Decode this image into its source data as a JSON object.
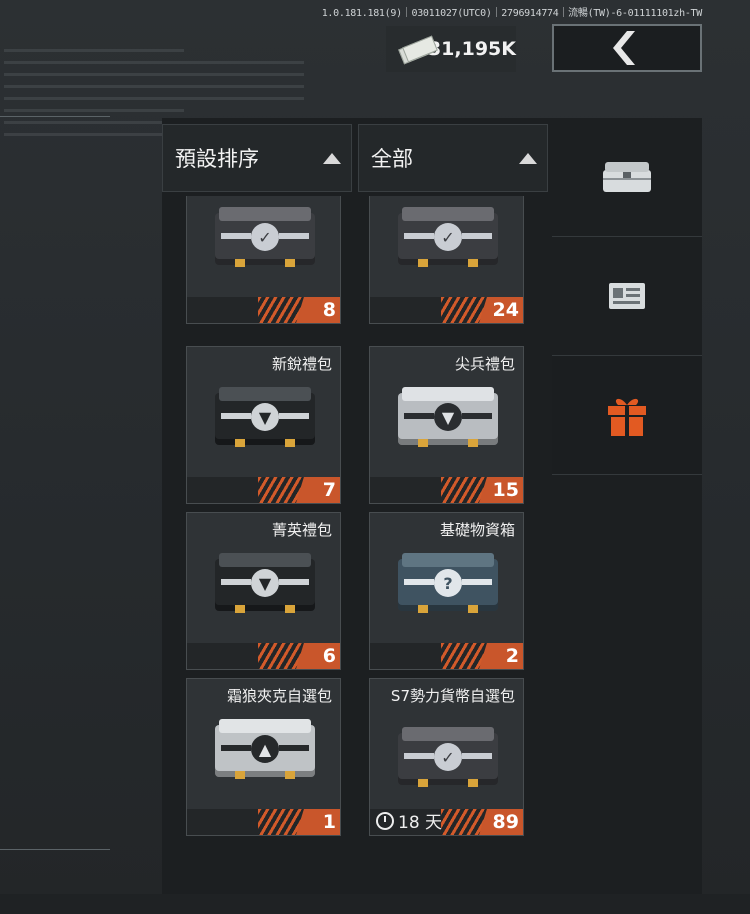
{
  "build_info": "1.0.181.181(9)｜03011027(UTC0)｜2796914774｜流暢(TW)-6-01111101zh-TW",
  "currency": {
    "icon": "cash-icon",
    "amount": "31,195K"
  },
  "back_button": {
    "icon": "chevron-left-icon"
  },
  "sort": {
    "label": "預設排序",
    "icon": "triangle-up-icon"
  },
  "filter": {
    "label": "全部",
    "icon": "triangle-up-icon"
  },
  "sidebar": [
    {
      "icon": "chest-icon",
      "active": false
    },
    {
      "icon": "card-icon",
      "active": false
    },
    {
      "icon": "gift-icon",
      "active": true
    }
  ],
  "accent_color": "#d25a2a",
  "items": [
    {
      "name": "",
      "count": "8",
      "style": "shield-dark"
    },
    {
      "name": "",
      "count": "24",
      "style": "shield-dark"
    },
    {
      "name": "新銳禮包",
      "count": "7",
      "style": "chevron-dark"
    },
    {
      "name": "尖兵禮包",
      "count": "15",
      "style": "chevron-silver"
    },
    {
      "name": "菁英禮包",
      "count": "6",
      "style": "chevron-dark"
    },
    {
      "name": "基礎物資箱",
      "count": "2",
      "style": "question-blue"
    },
    {
      "name": "霜狼夾克自選包",
      "count": "1",
      "style": "triangle-silver"
    },
    {
      "name": "S7勢力貨幣自選包",
      "count": "89",
      "style": "shield-dark",
      "timer": "18 天"
    }
  ]
}
